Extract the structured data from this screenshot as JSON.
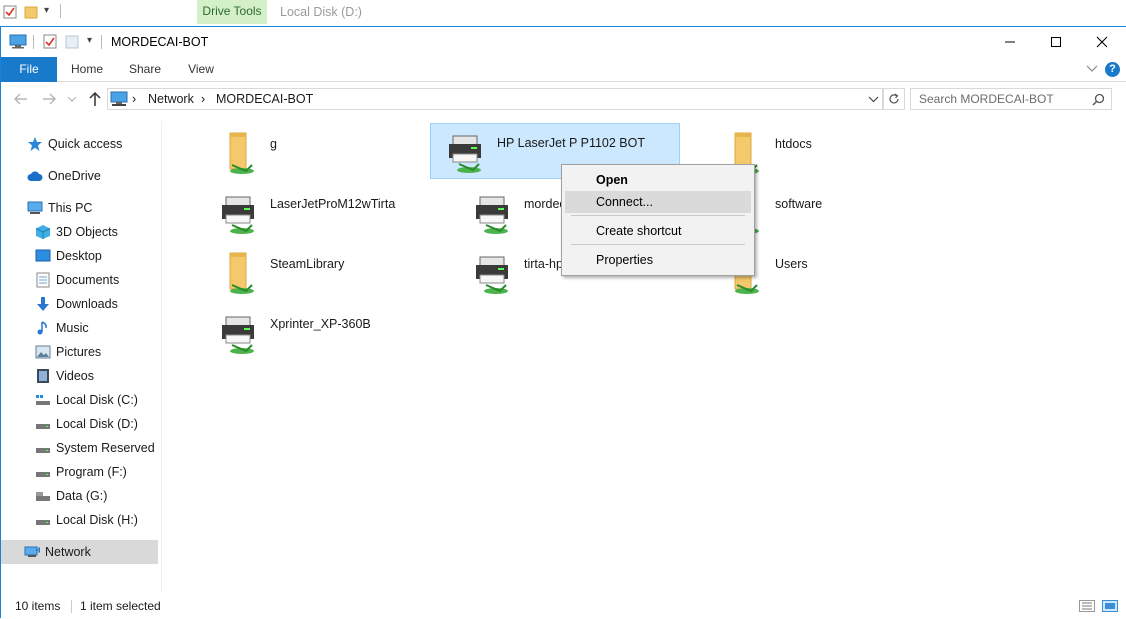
{
  "background_window": {
    "context_tab": "Drive Tools",
    "title": "Local Disk (D:)"
  },
  "window": {
    "title": "MORDECAI-BOT",
    "controls": {
      "minimize": "—",
      "maximize": "☐",
      "close": "✕"
    }
  },
  "ribbon": {
    "tabs": [
      {
        "label": "File"
      },
      {
        "label": "Home"
      },
      {
        "label": "Share"
      },
      {
        "label": "View"
      }
    ],
    "help": "?"
  },
  "address": {
    "crumbs": [
      "Network",
      "MORDECAI-BOT"
    ],
    "separator": "›",
    "search_placeholder": "Search MORDECAI-BOT"
  },
  "nav": {
    "items": [
      {
        "label": "Quick access",
        "icon": "star-icon"
      },
      {
        "label": "OneDrive",
        "icon": "cloud-icon"
      },
      {
        "label": "This PC",
        "icon": "computer-icon"
      },
      {
        "label": "3D Objects",
        "icon": "cube-icon"
      },
      {
        "label": "Desktop",
        "icon": "desktop-icon"
      },
      {
        "label": "Documents",
        "icon": "documents-icon"
      },
      {
        "label": "Downloads",
        "icon": "download-icon"
      },
      {
        "label": "Music",
        "icon": "music-icon"
      },
      {
        "label": "Pictures",
        "icon": "pictures-icon"
      },
      {
        "label": "Videos",
        "icon": "videos-icon"
      },
      {
        "label": "Local Disk (C:)",
        "icon": "drive-icon"
      },
      {
        "label": "Local Disk (D:)",
        "icon": "drive-icon"
      },
      {
        "label": "System Reserved (E:",
        "icon": "drive-icon"
      },
      {
        "label": "Program (F:)",
        "icon": "drive-icon"
      },
      {
        "label": "Data (G:)",
        "icon": "drive-icon"
      },
      {
        "label": "Local Disk (H:)",
        "icon": "drive-icon"
      },
      {
        "label": "Network",
        "icon": "network-icon"
      }
    ]
  },
  "content": {
    "items": [
      {
        "label": "g",
        "type": "folder"
      },
      {
        "label": "HP LaserJet P P1102 BOT",
        "type": "printer"
      },
      {
        "label": "htdocs",
        "type": "folder"
      },
      {
        "label": "LaserJetProM12wTirta",
        "type": "printer"
      },
      {
        "label": "mordec",
        "type": "printer"
      },
      {
        "label": "software",
        "type": "folder"
      },
      {
        "label": "SteamLibrary",
        "type": "folder"
      },
      {
        "label": "tirta-hp",
        "type": "printer"
      },
      {
        "label": "Users",
        "type": "folder"
      },
      {
        "label": "Xprinter_XP-360B",
        "type": "printer"
      }
    ]
  },
  "context_menu": {
    "open": "Open",
    "connect": "Connect...",
    "create_shortcut": "Create shortcut",
    "properties": "Properties"
  },
  "status": {
    "count": "10 items",
    "selected": "1 item selected"
  },
  "colors": {
    "accent": "#1979ca",
    "selection": "#cce8ff",
    "folder": "#f4c96b",
    "share_green": "#4cb24c"
  }
}
